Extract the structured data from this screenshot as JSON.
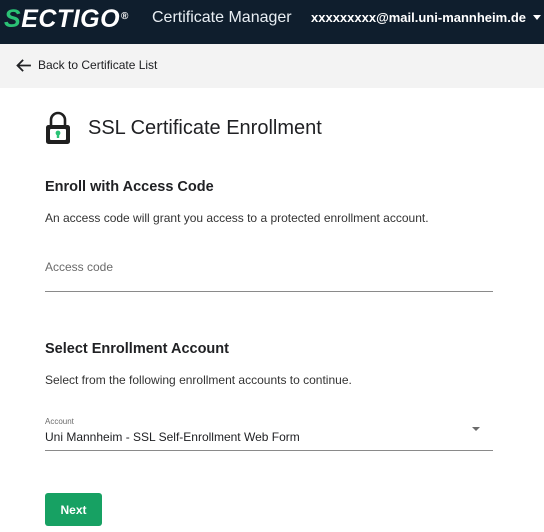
{
  "header": {
    "logo_first": "S",
    "logo_rest": "ECTIGO",
    "logo_mark": "®",
    "app_title": "Certificate Manager",
    "user_email": "xxxxxxxxx@mail.uni-mannheim.de"
  },
  "backbar": {
    "label": "Back to Certificate List"
  },
  "page": {
    "title": "SSL Certificate Enrollment"
  },
  "access_code": {
    "title": "Enroll with Access Code",
    "description": "An access code will grant you access to a protected enrollment account.",
    "placeholder": "Access code",
    "value": ""
  },
  "account": {
    "title": "Select Enrollment Account",
    "description": "Select from the following enrollment accounts to continue.",
    "field_label": "Account",
    "selected": "Uni Mannheim - SSL Self-Enrollment Web Form"
  },
  "actions": {
    "next_label": "Next"
  },
  "colors": {
    "header_bg": "#0f1e2d",
    "brand_green": "#2bc275",
    "button_green": "#17a163"
  },
  "icons": {
    "back": "arrow-left-icon",
    "lock": "lock-icon",
    "user_menu": "caret-down-icon",
    "select": "caret-down-icon"
  }
}
